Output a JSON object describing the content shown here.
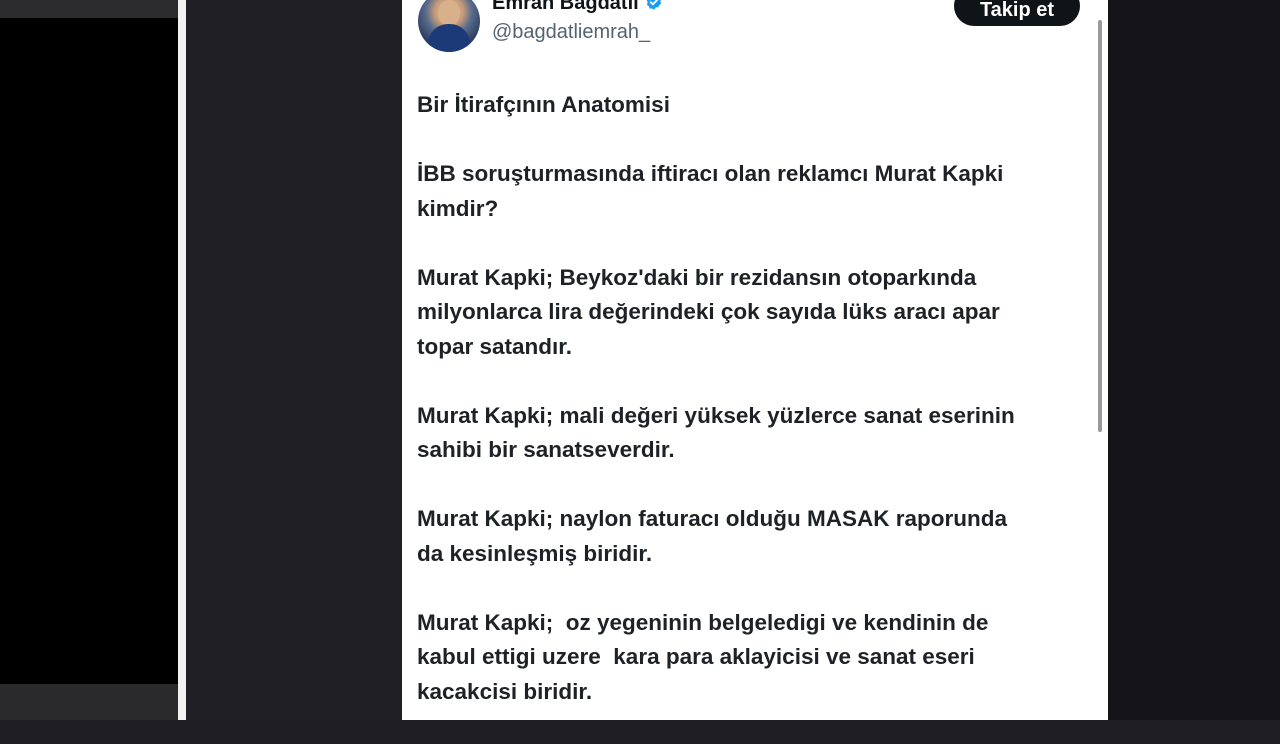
{
  "tweet": {
    "author": {
      "name": "Emrah Bağdatlı",
      "handle": "@bagdatliemrah_",
      "verified": true,
      "verified_color": "#1d9bf0"
    },
    "follow_label": "Takip et",
    "paragraphs": [
      "Bir İtirafçının Anatomisi",
      "İBB soruşturmasında iftiracı olan reklamcı Murat Kapki\nkimdir?",
      "Murat Kapki; Beykoz'daki bir rezidansın otoparkında\nmilyonlarca lira değerindeki çok sayıda lüks aracı apar\ntopar satandır.",
      "Murat Kapki; mali değeri yüksek yüzlerce sanat eserinin\nsahibi bir sanatseverdir.",
      "Murat Kapki; naylon faturacı olduğu MASAK raporunda\nda kesinleşmiş biridir.",
      "Murat Kapki;  oz yegeninin belgeledigi ve kendinin de\nkabul ettigi uzere  kara para aklayicisi ve sanat eseri\nkacakcisi biridir."
    ]
  }
}
